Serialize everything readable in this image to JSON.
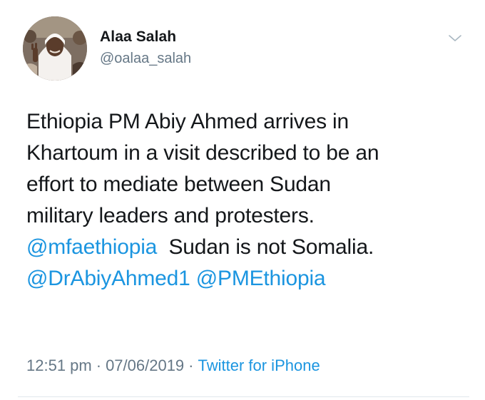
{
  "author": {
    "name": "Alaa Salah",
    "handle": "@oalaa_salah"
  },
  "tweet": {
    "line1": "Ethiopia PM Abiy Ahmed arrives in",
    "line2": "Khartoum in a visit described to be an",
    "line3": "effort to mediate between Sudan",
    "line4": "military leaders and protesters.",
    "mention1": "@mfaethiopia",
    "line5_rest": "Sudan is not Somalia.",
    "mention2": "@DrAbiyAhmed1",
    "mention3": "@PMEthiopia"
  },
  "meta": {
    "time": "12:51 pm",
    "date": "07/06/2019",
    "separator": "·",
    "source": "Twitter for iPhone"
  },
  "icons": {
    "menu": "chevron-down-icon"
  },
  "colors": {
    "text": "#14171a",
    "secondary": "#657786",
    "link": "#1b95e0"
  }
}
